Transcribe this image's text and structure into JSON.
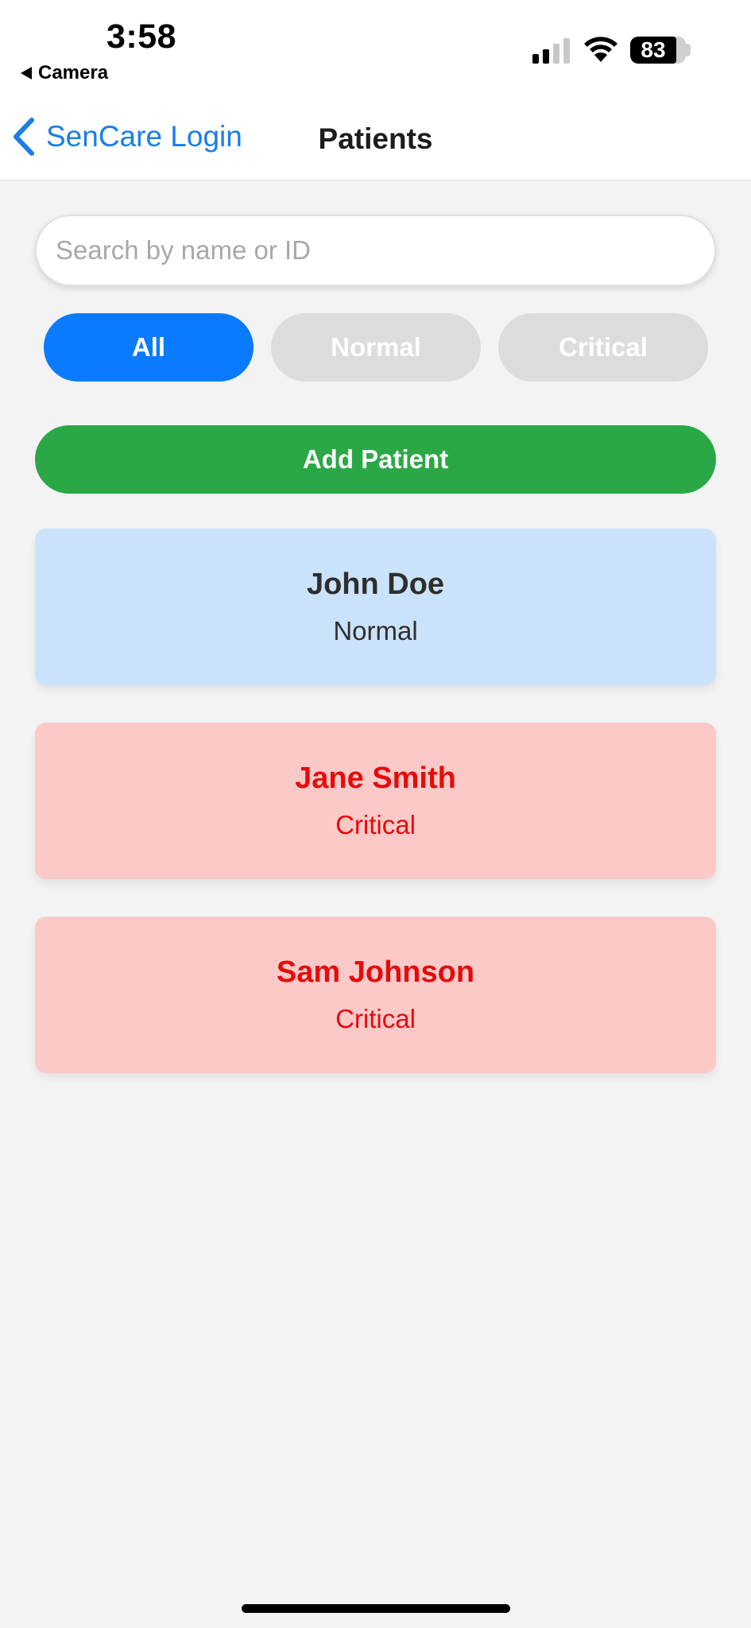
{
  "status_bar": {
    "time": "3:58",
    "back_app": "Camera",
    "battery": "83",
    "battery_level": 0.83,
    "signal_bars_active": 2,
    "signal_bars_total": 4
  },
  "nav": {
    "back_label": "SenCare Login",
    "title": "Patients",
    "accent_color": "#1a7ee6"
  },
  "search": {
    "placeholder": "Search by name or ID",
    "value": ""
  },
  "filters": [
    {
      "label": "All",
      "active": true
    },
    {
      "label": "Normal",
      "active": false
    },
    {
      "label": "Critical",
      "active": false
    }
  ],
  "add_button": {
    "label": "Add Patient",
    "color": "#2aa846"
  },
  "patients": [
    {
      "name": "John Doe",
      "status": "Normal",
      "color": "#cae3fb"
    },
    {
      "name": "Jane Smith",
      "status": "Critical",
      "color": "#fcc9c9"
    },
    {
      "name": "Sam Johnson",
      "status": "Critical",
      "color": "#fcc9c9"
    }
  ]
}
